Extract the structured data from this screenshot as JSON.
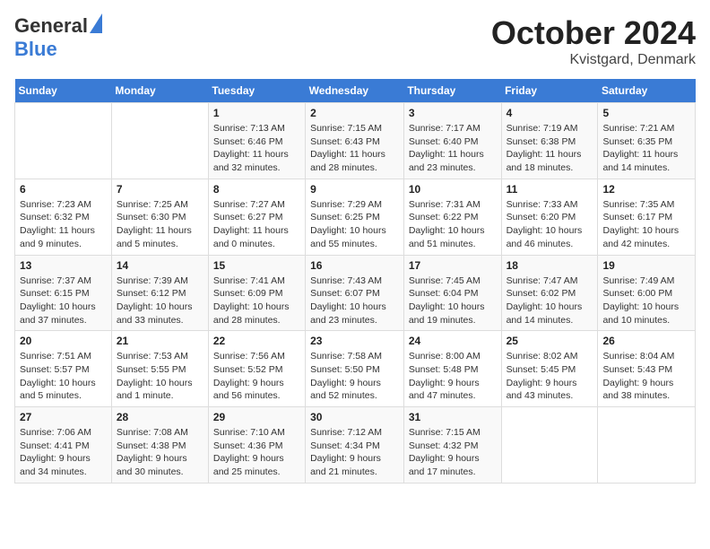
{
  "logo": {
    "general": "General",
    "blue": "Blue"
  },
  "header": {
    "month": "October 2024",
    "location": "Kvistgard, Denmark"
  },
  "weekdays": [
    "Sunday",
    "Monday",
    "Tuesday",
    "Wednesday",
    "Thursday",
    "Friday",
    "Saturday"
  ],
  "weeks": [
    [
      {
        "day": "",
        "sunrise": "",
        "sunset": "",
        "daylight": ""
      },
      {
        "day": "",
        "sunrise": "",
        "sunset": "",
        "daylight": ""
      },
      {
        "day": "1",
        "sunrise": "Sunrise: 7:13 AM",
        "sunset": "Sunset: 6:46 PM",
        "daylight": "Daylight: 11 hours and 32 minutes."
      },
      {
        "day": "2",
        "sunrise": "Sunrise: 7:15 AM",
        "sunset": "Sunset: 6:43 PM",
        "daylight": "Daylight: 11 hours and 28 minutes."
      },
      {
        "day": "3",
        "sunrise": "Sunrise: 7:17 AM",
        "sunset": "Sunset: 6:40 PM",
        "daylight": "Daylight: 11 hours and 23 minutes."
      },
      {
        "day": "4",
        "sunrise": "Sunrise: 7:19 AM",
        "sunset": "Sunset: 6:38 PM",
        "daylight": "Daylight: 11 hours and 18 minutes."
      },
      {
        "day": "5",
        "sunrise": "Sunrise: 7:21 AM",
        "sunset": "Sunset: 6:35 PM",
        "daylight": "Daylight: 11 hours and 14 minutes."
      }
    ],
    [
      {
        "day": "6",
        "sunrise": "Sunrise: 7:23 AM",
        "sunset": "Sunset: 6:32 PM",
        "daylight": "Daylight: 11 hours and 9 minutes."
      },
      {
        "day": "7",
        "sunrise": "Sunrise: 7:25 AM",
        "sunset": "Sunset: 6:30 PM",
        "daylight": "Daylight: 11 hours and 5 minutes."
      },
      {
        "day": "8",
        "sunrise": "Sunrise: 7:27 AM",
        "sunset": "Sunset: 6:27 PM",
        "daylight": "Daylight: 11 hours and 0 minutes."
      },
      {
        "day": "9",
        "sunrise": "Sunrise: 7:29 AM",
        "sunset": "Sunset: 6:25 PM",
        "daylight": "Daylight: 10 hours and 55 minutes."
      },
      {
        "day": "10",
        "sunrise": "Sunrise: 7:31 AM",
        "sunset": "Sunset: 6:22 PM",
        "daylight": "Daylight: 10 hours and 51 minutes."
      },
      {
        "day": "11",
        "sunrise": "Sunrise: 7:33 AM",
        "sunset": "Sunset: 6:20 PM",
        "daylight": "Daylight: 10 hours and 46 minutes."
      },
      {
        "day": "12",
        "sunrise": "Sunrise: 7:35 AM",
        "sunset": "Sunset: 6:17 PM",
        "daylight": "Daylight: 10 hours and 42 minutes."
      }
    ],
    [
      {
        "day": "13",
        "sunrise": "Sunrise: 7:37 AM",
        "sunset": "Sunset: 6:15 PM",
        "daylight": "Daylight: 10 hours and 37 minutes."
      },
      {
        "day": "14",
        "sunrise": "Sunrise: 7:39 AM",
        "sunset": "Sunset: 6:12 PM",
        "daylight": "Daylight: 10 hours and 33 minutes."
      },
      {
        "day": "15",
        "sunrise": "Sunrise: 7:41 AM",
        "sunset": "Sunset: 6:09 PM",
        "daylight": "Daylight: 10 hours and 28 minutes."
      },
      {
        "day": "16",
        "sunrise": "Sunrise: 7:43 AM",
        "sunset": "Sunset: 6:07 PM",
        "daylight": "Daylight: 10 hours and 23 minutes."
      },
      {
        "day": "17",
        "sunrise": "Sunrise: 7:45 AM",
        "sunset": "Sunset: 6:04 PM",
        "daylight": "Daylight: 10 hours and 19 minutes."
      },
      {
        "day": "18",
        "sunrise": "Sunrise: 7:47 AM",
        "sunset": "Sunset: 6:02 PM",
        "daylight": "Daylight: 10 hours and 14 minutes."
      },
      {
        "day": "19",
        "sunrise": "Sunrise: 7:49 AM",
        "sunset": "Sunset: 6:00 PM",
        "daylight": "Daylight: 10 hours and 10 minutes."
      }
    ],
    [
      {
        "day": "20",
        "sunrise": "Sunrise: 7:51 AM",
        "sunset": "Sunset: 5:57 PM",
        "daylight": "Daylight: 10 hours and 5 minutes."
      },
      {
        "day": "21",
        "sunrise": "Sunrise: 7:53 AM",
        "sunset": "Sunset: 5:55 PM",
        "daylight": "Daylight: 10 hours and 1 minute."
      },
      {
        "day": "22",
        "sunrise": "Sunrise: 7:56 AM",
        "sunset": "Sunset: 5:52 PM",
        "daylight": "Daylight: 9 hours and 56 minutes."
      },
      {
        "day": "23",
        "sunrise": "Sunrise: 7:58 AM",
        "sunset": "Sunset: 5:50 PM",
        "daylight": "Daylight: 9 hours and 52 minutes."
      },
      {
        "day": "24",
        "sunrise": "Sunrise: 8:00 AM",
        "sunset": "Sunset: 5:48 PM",
        "daylight": "Daylight: 9 hours and 47 minutes."
      },
      {
        "day": "25",
        "sunrise": "Sunrise: 8:02 AM",
        "sunset": "Sunset: 5:45 PM",
        "daylight": "Daylight: 9 hours and 43 minutes."
      },
      {
        "day": "26",
        "sunrise": "Sunrise: 8:04 AM",
        "sunset": "Sunset: 5:43 PM",
        "daylight": "Daylight: 9 hours and 38 minutes."
      }
    ],
    [
      {
        "day": "27",
        "sunrise": "Sunrise: 7:06 AM",
        "sunset": "Sunset: 4:41 PM",
        "daylight": "Daylight: 9 hours and 34 minutes."
      },
      {
        "day": "28",
        "sunrise": "Sunrise: 7:08 AM",
        "sunset": "Sunset: 4:38 PM",
        "daylight": "Daylight: 9 hours and 30 minutes."
      },
      {
        "day": "29",
        "sunrise": "Sunrise: 7:10 AM",
        "sunset": "Sunset: 4:36 PM",
        "daylight": "Daylight: 9 hours and 25 minutes."
      },
      {
        "day": "30",
        "sunrise": "Sunrise: 7:12 AM",
        "sunset": "Sunset: 4:34 PM",
        "daylight": "Daylight: 9 hours and 21 minutes."
      },
      {
        "day": "31",
        "sunrise": "Sunrise: 7:15 AM",
        "sunset": "Sunset: 4:32 PM",
        "daylight": "Daylight: 9 hours and 17 minutes."
      },
      {
        "day": "",
        "sunrise": "",
        "sunset": "",
        "daylight": ""
      },
      {
        "day": "",
        "sunrise": "",
        "sunset": "",
        "daylight": ""
      }
    ]
  ]
}
